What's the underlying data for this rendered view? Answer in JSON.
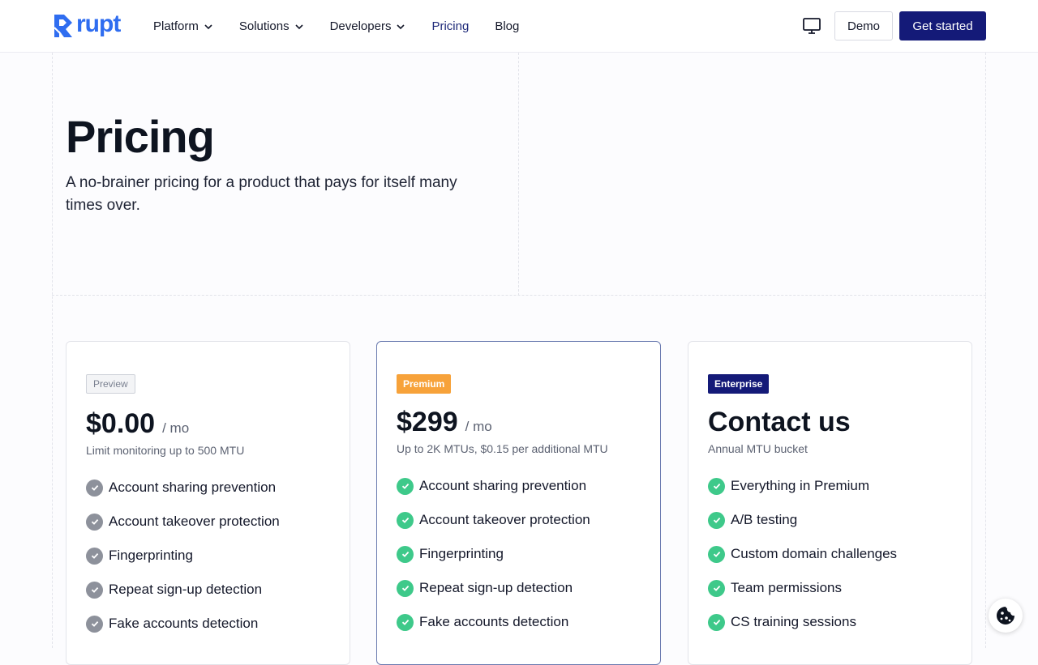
{
  "brand": {
    "name": "rupt",
    "color": "#2f6df0"
  },
  "nav": {
    "items": [
      {
        "label": "Platform",
        "has_dropdown": true
      },
      {
        "label": "Solutions",
        "has_dropdown": true
      },
      {
        "label": "Developers",
        "has_dropdown": true
      },
      {
        "label": "Pricing",
        "has_dropdown": false,
        "active": true
      },
      {
        "label": "Blog",
        "has_dropdown": false
      }
    ],
    "monitor_icon": "monitor-icon",
    "demo_label": "Demo",
    "get_started_label": "Get started"
  },
  "hero": {
    "title": "Pricing",
    "subtitle": "A no-brainer pricing for a product that pays for itself many times over."
  },
  "plans": [
    {
      "badge": "Preview",
      "price": "$0.00",
      "unit": "/ mo",
      "description": "Limit monitoring up to 500 MTU",
      "features": [
        "Account sharing prevention",
        "Account takeover protection",
        "Fingerprinting",
        "Repeat sign-up detection",
        "Fake accounts detection"
      ]
    },
    {
      "badge": "Premium",
      "price": "$299",
      "unit": "/ mo",
      "description": "Up to 2K MTUs, $0.15 per additional MTU",
      "features": [
        "Account sharing prevention",
        "Account takeover protection",
        "Fingerprinting",
        "Repeat sign-up detection",
        "Fake accounts detection"
      ]
    },
    {
      "badge": "Enterprise",
      "price": "Contact us",
      "unit": "",
      "description": "Annual MTU bucket",
      "features": [
        "Everything in Premium",
        "A/B testing",
        "Custom domain challenges",
        "Team permissions",
        "CS training sessions"
      ]
    }
  ],
  "colors": {
    "primary": "#141a78",
    "premium_badge": "#f7a23a",
    "check_active": "#3ec98a",
    "check_inactive": "#8d919b"
  },
  "cookie_icon": "cookie-icon"
}
